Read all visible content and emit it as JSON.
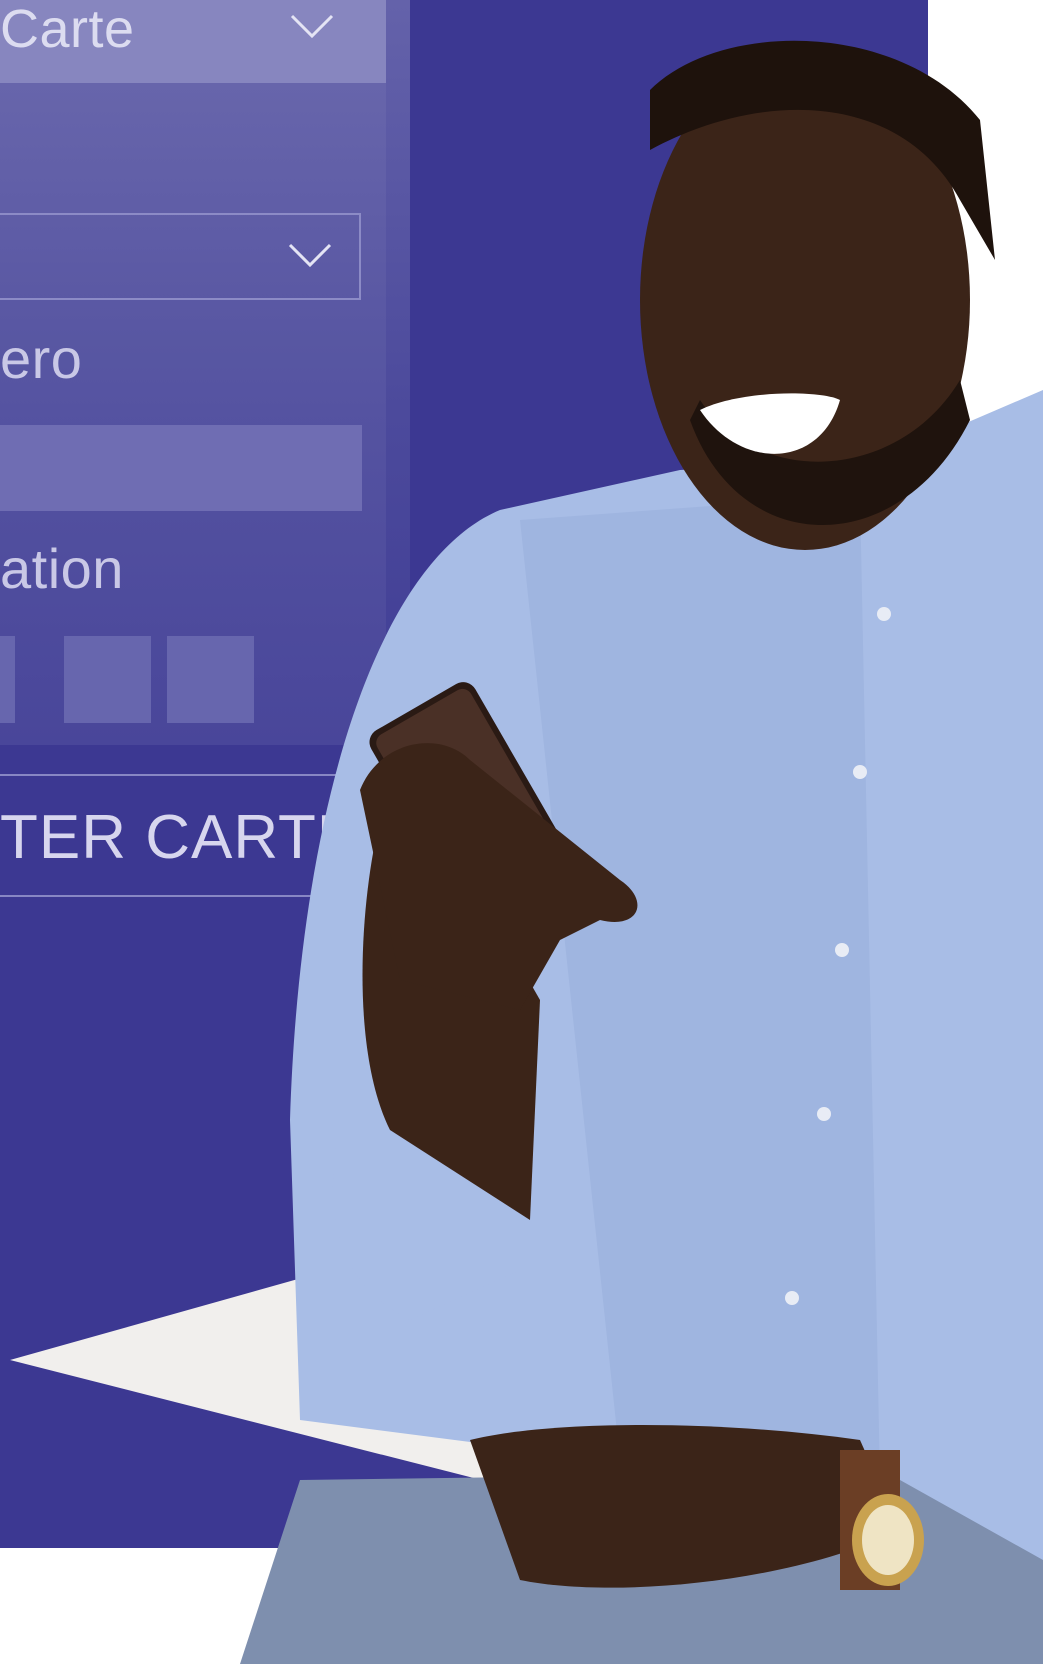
{
  "form": {
    "select_top_label": "Carte",
    "select_second_value": "",
    "number_label": "ero",
    "number_value": "",
    "activation_label": "ation",
    "pin_boxes": [
      "",
      "",
      ""
    ],
    "submit_label": "TER CARTE"
  },
  "colors": {
    "brand_background": "#3c3892",
    "panel": "#5654a3",
    "field_fill": "#6f6db3",
    "text": "#d7d6ee"
  },
  "icons": [
    "chevron-down-icon",
    "chevron-down-icon"
  ]
}
